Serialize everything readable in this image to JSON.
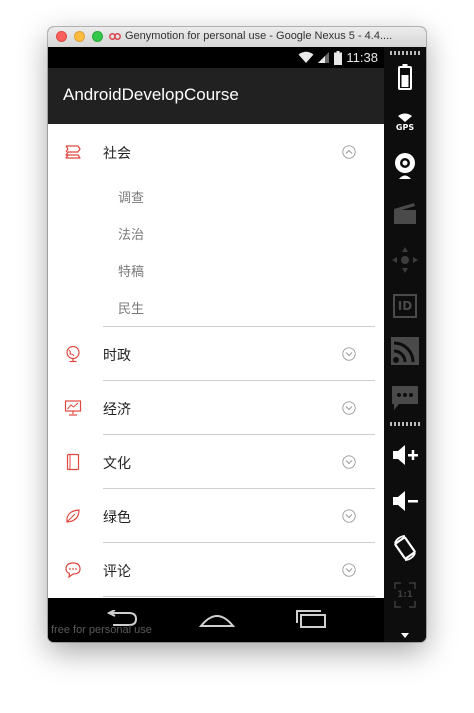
{
  "window": {
    "title": "Genymotion for personal use - Google Nexus 5 - 4.4...."
  },
  "statusbar": {
    "time": "11:38"
  },
  "app": {
    "title": "AndroidDevelopCourse"
  },
  "menu": {
    "groups": [
      {
        "label": "社会",
        "icon": "tag-icon",
        "expanded": true,
        "children": [
          "调查",
          "法治",
          "特稿",
          "民生"
        ]
      },
      {
        "label": "时政",
        "icon": "globe-icon",
        "expanded": false
      },
      {
        "label": "经济",
        "icon": "chart-board-icon",
        "expanded": false
      },
      {
        "label": "文化",
        "icon": "book-icon",
        "expanded": false
      },
      {
        "label": "绿色",
        "icon": "leaf-icon",
        "expanded": false
      },
      {
        "label": "评论",
        "icon": "chat-bubble-icon",
        "expanded": false
      }
    ]
  },
  "navbar": {
    "watermark": "free for personal use"
  },
  "sidebar": {
    "gps_label": "GPS",
    "id_label": "ID",
    "ratio_label": "1:1"
  },
  "colors": {
    "accent": "#e0473e",
    "actionbar": "#212121",
    "divider": "#cfcfcf"
  }
}
